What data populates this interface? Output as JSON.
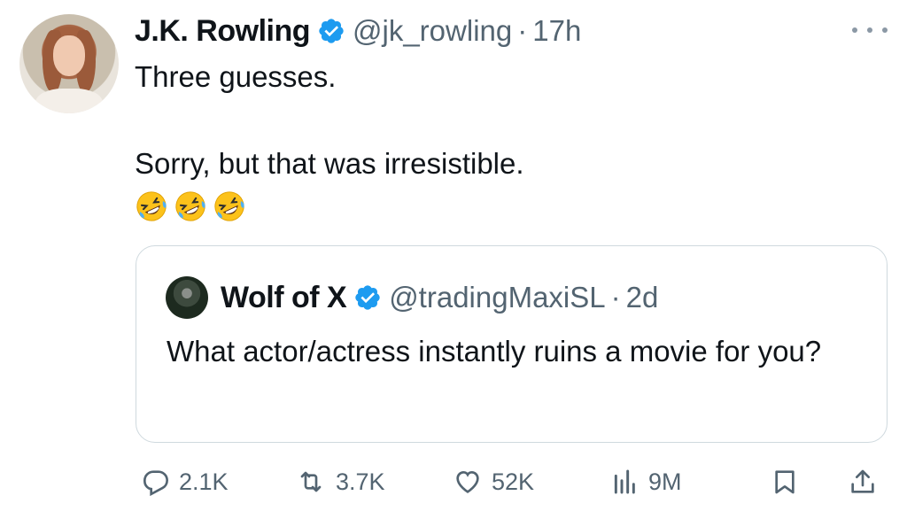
{
  "tweet": {
    "author": {
      "display_name": "J.K. Rowling",
      "handle": "@jk_rowling",
      "verified_icon": "verified-badge-icon"
    },
    "separator": "·",
    "time": "17h",
    "text_lines": [
      "Three guesses.",
      "Sorry, but that was irresistible."
    ],
    "emojis": [
      "rolling-on-floor-laughing",
      "rolling-on-floor-laughing",
      "rolling-on-floor-laughing"
    ],
    "more_icon": "more-options-icon"
  },
  "quoted_tweet": {
    "author": {
      "display_name": "Wolf of X",
      "handle": "@tradingMaxiSL",
      "verified_icon": "verified-badge-icon"
    },
    "separator": "·",
    "time": "2d",
    "text": "What actor/actress instantly ruins a movie for you?"
  },
  "actions": {
    "reply": {
      "icon": "reply-icon",
      "count": "2.1K"
    },
    "repost": {
      "icon": "repost-icon",
      "count": "3.7K"
    },
    "like": {
      "icon": "heart-icon",
      "count": "52K"
    },
    "views": {
      "icon": "views-icon",
      "count": "9M"
    },
    "bookmark": {
      "icon": "bookmark-icon"
    },
    "share": {
      "icon": "share-icon"
    }
  },
  "colors": {
    "verified": "#1d9bf0",
    "secondary_text": "#536471",
    "border": "#cfd9de",
    "text": "#0f1419"
  }
}
